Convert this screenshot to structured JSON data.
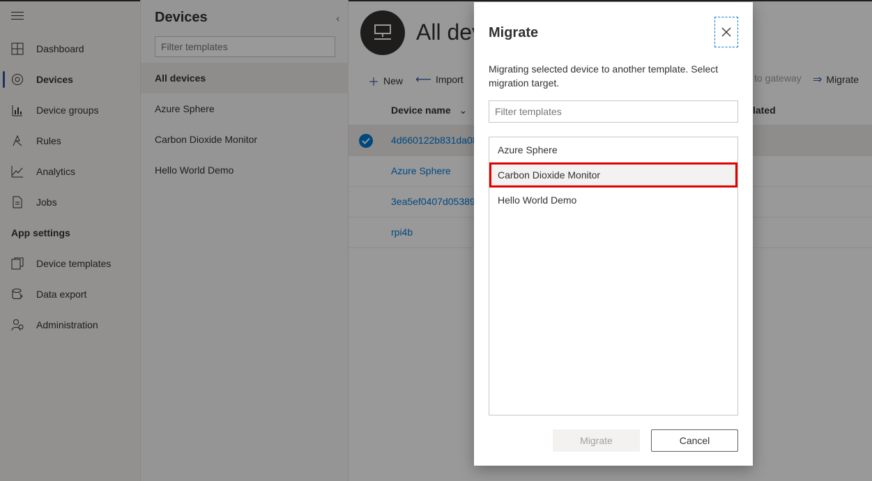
{
  "left_nav": {
    "items": [
      {
        "label": "Dashboard",
        "icon": "dashboard-icon"
      },
      {
        "label": "Devices",
        "icon": "devices-icon",
        "active": true
      },
      {
        "label": "Device groups",
        "icon": "device-groups-icon"
      },
      {
        "label": "Rules",
        "icon": "rules-icon"
      },
      {
        "label": "Analytics",
        "icon": "analytics-icon"
      },
      {
        "label": "Jobs",
        "icon": "jobs-icon"
      }
    ],
    "section_label": "App settings",
    "settings_items": [
      {
        "label": "Device templates",
        "icon": "device-templates-icon"
      },
      {
        "label": "Data export",
        "icon": "data-export-icon"
      },
      {
        "label": "Administration",
        "icon": "administration-icon"
      }
    ]
  },
  "devices_panel": {
    "title": "Devices",
    "filter_placeholder": "Filter templates",
    "items": [
      {
        "label": "All devices",
        "active": true
      },
      {
        "label": "Azure Sphere"
      },
      {
        "label": "Carbon Dioxide Monitor"
      },
      {
        "label": "Hello World Demo"
      }
    ]
  },
  "main": {
    "title": "All dev",
    "commands": [
      {
        "label": "New",
        "icon": "plus-icon"
      },
      {
        "label": "Import",
        "icon": "import-icon"
      },
      {
        "label": "to gateway",
        "icon": ""
      },
      {
        "label": "Migrate",
        "icon": "migrate-icon"
      }
    ],
    "columns": [
      "Device name",
      "lated"
    ],
    "rows": [
      {
        "device_name": "4d660122b831da08",
        "selected": true
      },
      {
        "device_name": "Azure Sphere"
      },
      {
        "device_name": "3ea5ef0407d05389"
      },
      {
        "device_name": "rpi4b"
      }
    ]
  },
  "dialog": {
    "title": "Migrate",
    "description": "Migrating selected device to another template. Select migration target.",
    "filter_placeholder": "Filter templates",
    "options": [
      {
        "label": "Azure Sphere"
      },
      {
        "label": "Carbon Dioxide Monitor",
        "selected": true
      },
      {
        "label": "Hello World Demo"
      }
    ],
    "primary_button": "Migrate",
    "secondary_button": "Cancel"
  },
  "colors": {
    "accent": "#0078d4",
    "highlight_outline": "#e00000",
    "overlay": "rgba(0,0,0,0.4)"
  }
}
